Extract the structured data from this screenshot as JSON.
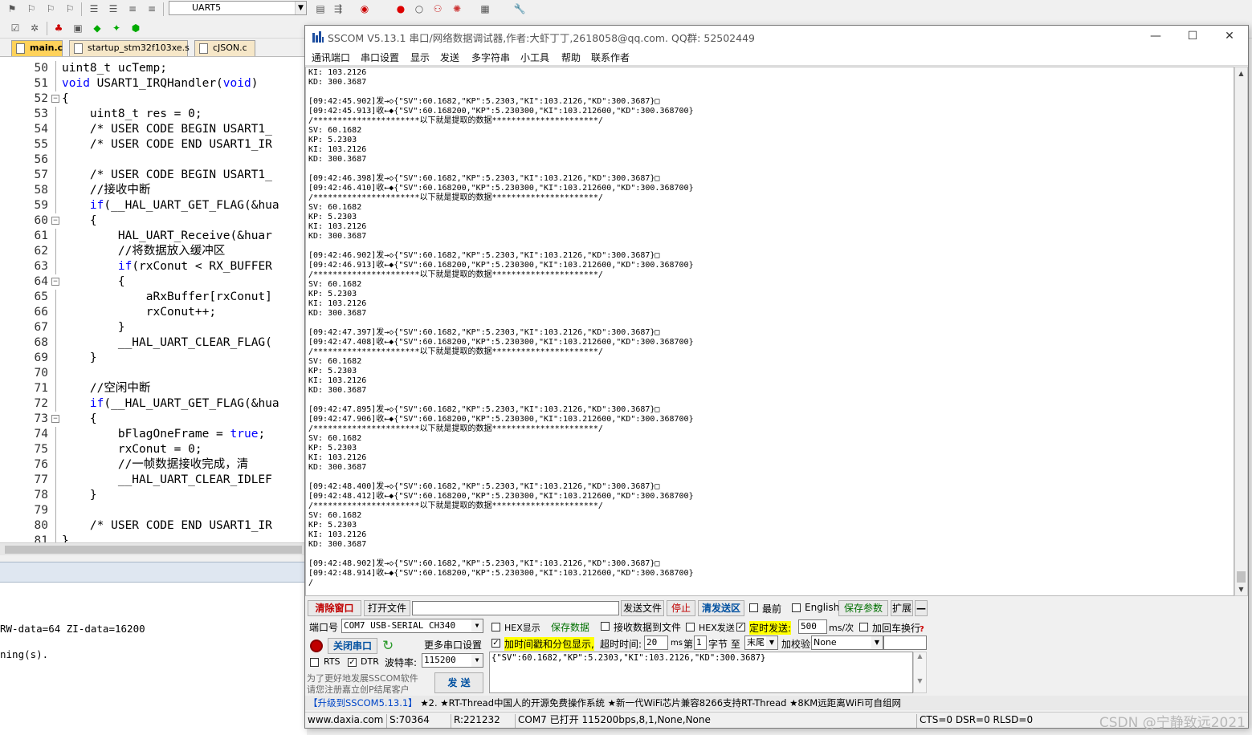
{
  "ide": {
    "target_name": "UART5",
    "tabs": [
      {
        "label": "main.c",
        "active": true
      },
      {
        "label": "startup_stm32f103xe.s",
        "active": false
      },
      {
        "label": "cJSON.c",
        "active": false
      }
    ],
    "code_lines": [
      {
        "n": "50",
        "text": "uint8_t ucTemp;",
        "type": "code"
      },
      {
        "n": "51",
        "text": "void USART1_IRQHandler(void)",
        "type": "fn"
      },
      {
        "n": "52",
        "text": "{",
        "type": "code"
      },
      {
        "n": "53",
        "text": "    uint8_t res = 0;",
        "type": "code"
      },
      {
        "n": "54",
        "text": "    /* USER CODE BEGIN USART1_",
        "type": "comment"
      },
      {
        "n": "55",
        "text": "    /* USER CODE END USART1_IR",
        "type": "comment"
      },
      {
        "n": "56",
        "text": "",
        "type": "code"
      },
      {
        "n": "57",
        "text": "    /* USER CODE BEGIN USART1_",
        "type": "comment"
      },
      {
        "n": "58",
        "text": "    //接收中断",
        "type": "comment"
      },
      {
        "n": "59",
        "text": "    if(__HAL_UART_GET_FLAG(&hua",
        "type": "if"
      },
      {
        "n": "60",
        "text": "    {",
        "type": "code"
      },
      {
        "n": "61",
        "text": "        HAL_UART_Receive(&huar",
        "type": "code"
      },
      {
        "n": "62",
        "text": "        //将数据放入缓冲区",
        "type": "comment"
      },
      {
        "n": "63",
        "text": "        if(rxConut < RX_BUFFER",
        "type": "if"
      },
      {
        "n": "64",
        "text": "        {",
        "type": "code"
      },
      {
        "n": "65",
        "text": "            aRxBuffer[rxConut]",
        "type": "code"
      },
      {
        "n": "66",
        "text": "            rxConut++;",
        "type": "code"
      },
      {
        "n": "67",
        "text": "        }",
        "type": "code"
      },
      {
        "n": "68",
        "text": "        __HAL_UART_CLEAR_FLAG(",
        "type": "code"
      },
      {
        "n": "69",
        "text": "    }",
        "type": "code"
      },
      {
        "n": "70",
        "text": "",
        "type": "code"
      },
      {
        "n": "71",
        "text": "    //空闲中断",
        "type": "comment"
      },
      {
        "n": "72",
        "text": "    if(__HAL_UART_GET_FLAG(&hua",
        "type": "if"
      },
      {
        "n": "73",
        "text": "    {",
        "type": "code"
      },
      {
        "n": "74",
        "text": "        bFlagOneFrame = true;",
        "type": "true"
      },
      {
        "n": "75",
        "text": "        rxConut = 0;",
        "type": "code"
      },
      {
        "n": "76",
        "text": "        //一帧数据接收完成，清",
        "type": "comment"
      },
      {
        "n": "77",
        "text": "        __HAL_UART_CLEAR_IDLEF",
        "type": "code"
      },
      {
        "n": "78",
        "text": "    }",
        "type": "code"
      },
      {
        "n": "79",
        "text": "",
        "type": "code"
      },
      {
        "n": "80",
        "text": "    /* USER CODE END USART1_IR",
        "type": "comment"
      },
      {
        "n": "81",
        "text": "}",
        "type": "code"
      }
    ],
    "build_output": [
      "RW-data=64 ZI-data=16200",
      "ning(s)."
    ]
  },
  "sscom": {
    "title": "SSCOM V5.13.1 串口/网络数据调试器,作者:大虾丁丁,2618058@qq.com. QQ群: 52502449",
    "menu": [
      "通讯端口",
      "串口设置",
      "显示",
      "发送",
      "多字符串",
      "小工具",
      "帮助",
      "联系作者"
    ],
    "receive_lines": [
      "KI: 103.2126",
      "KD: 300.3687",
      "",
      "[09:42:45.902]发→◇{\"SV\":60.1682,\"KP\":5.2303,\"KI\":103.2126,\"KD\":300.3687}□",
      "[09:42:45.913]收←◆{\"SV\":60.168200,\"KP\":5.230300,\"KI\":103.212600,\"KD\":300.368700}",
      "/**********************以下就是提取的数据**********************/",
      "SV: 60.1682",
      "KP: 5.2303",
      "KI: 103.2126",
      "KD: 300.3687",
      "",
      "[09:42:46.398]发→◇{\"SV\":60.1682,\"KP\":5.2303,\"KI\":103.2126,\"KD\":300.3687}□",
      "[09:42:46.410]收←◆{\"SV\":60.168200,\"KP\":5.230300,\"KI\":103.212600,\"KD\":300.368700}",
      "/**********************以下就是提取的数据**********************/",
      "SV: 60.1682",
      "KP: 5.2303",
      "KI: 103.2126",
      "KD: 300.3687",
      "",
      "[09:42:46.902]发→◇{\"SV\":60.1682,\"KP\":5.2303,\"KI\":103.2126,\"KD\":300.3687}□",
      "[09:42:46.913]收←◆{\"SV\":60.168200,\"KP\":5.230300,\"KI\":103.212600,\"KD\":300.368700}",
      "/**********************以下就是提取的数据**********************/",
      "SV: 60.1682",
      "KP: 5.2303",
      "KI: 103.2126",
      "KD: 300.3687",
      "",
      "[09:42:47.397]发→◇{\"SV\":60.1682,\"KP\":5.2303,\"KI\":103.2126,\"KD\":300.3687}□",
      "[09:42:47.408]收←◆{\"SV\":60.168200,\"KP\":5.230300,\"KI\":103.212600,\"KD\":300.368700}",
      "/**********************以下就是提取的数据**********************/",
      "SV: 60.1682",
      "KP: 5.2303",
      "KI: 103.2126",
      "KD: 300.3687",
      "",
      "[09:42:47.895]发→◇{\"SV\":60.1682,\"KP\":5.2303,\"KI\":103.2126,\"KD\":300.3687}□",
      "[09:42:47.906]收←◆{\"SV\":60.168200,\"KP\":5.230300,\"KI\":103.212600,\"KD\":300.368700}",
      "/**********************以下就是提取的数据**********************/",
      "SV: 60.1682",
      "KP: 5.2303",
      "KI: 103.2126",
      "KD: 300.3687",
      "",
      "[09:42:48.400]发→◇{\"SV\":60.1682,\"KP\":5.2303,\"KI\":103.2126,\"KD\":300.3687}□",
      "[09:42:48.412]收←◆{\"SV\":60.168200,\"KP\":5.230300,\"KI\":103.212600,\"KD\":300.368700}",
      "/**********************以下就是提取的数据**********************/",
      "SV: 60.1682",
      "KP: 5.2303",
      "KI: 103.2126",
      "KD: 300.3687",
      "",
      "[09:42:48.902]发→◇{\"SV\":60.1682,\"KP\":5.2303,\"KI\":103.2126,\"KD\":300.3687}□",
      "[09:42:48.914]收←◆{\"SV\":60.168200,\"KP\":5.230300,\"KI\":103.212600,\"KD\":300.368700}",
      "/"
    ],
    "row1": {
      "clear_window": "清除窗口",
      "open_file": "打开文件",
      "send_file": "发送文件",
      "stop": "停止",
      "clear_send": "清发送区",
      "topmost": "最前",
      "english": "English",
      "save_params": "保存参数",
      "expand": "扩展",
      "collapse": "—"
    },
    "port": {
      "port_label": "端口号",
      "port_value": "COM7 USB-SERIAL CH340",
      "close_port": "关闭串口",
      "more_settings": "更多串口设置",
      "rts": "RTS",
      "dtr": "DTR",
      "baud_label": "波特率:",
      "baud_value": "115200",
      "promo_line1": "为了更好地发展SSCOM软件",
      "promo_line2": "请您注册嘉立创P结尾客户",
      "send_button": "发 送"
    },
    "options": {
      "hex_display": "HEX显示",
      "save_data": "保存数据",
      "recv_to_file": "接收数据到文件",
      "hex_send": "HEX发送",
      "timed_send": "定时发送:",
      "interval_value": "500",
      "interval_unit": "ms/次",
      "add_crlf": "加回车换行",
      "timestamp": "加时间戳和分包显示,",
      "timeout_label": "超时时间:",
      "timeout_value": "20",
      "timeout_unit": "ms",
      "byte_from_label": "第",
      "byte_from_value": "1",
      "byte_to_label": "字节 至",
      "byte_to_value": "末尾",
      "checksum_label": "加校验",
      "checksum_value": "None"
    },
    "send_text": "{\"SV\":60.1682,\"KP\":5.2303,\"KI\":103.2126,\"KD\":300.3687}",
    "ad_bar": {
      "upgrade": "【升级到SSCOM5.13.1】",
      "text": "★2. ★RT-Thread中国人的开源免费操作系统 ★新一代WiFi芯片兼容8266支持RT-Thread ★8KM远距离WiFi可自组网"
    },
    "status": {
      "website": "www.daxia.com",
      "sent": "S:70364",
      "received": "R:221232",
      "port_status": "COM7 已打开  115200bps,8,1,None,None",
      "lines": "CTS=0 DSR=0 RLSD=0"
    }
  },
  "watermark": "CSDN @宁静致远2021"
}
